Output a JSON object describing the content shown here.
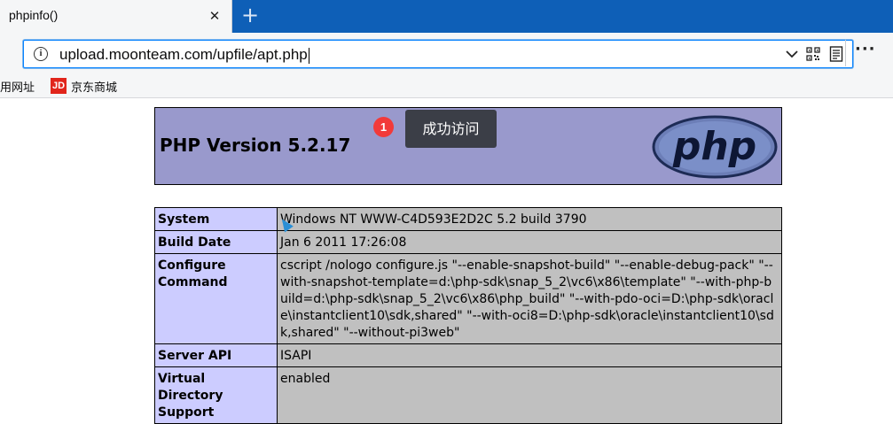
{
  "tab": {
    "title": "phpinfo()",
    "close_glyph": "✕",
    "new_tab_glyph": "+"
  },
  "address_bar": {
    "url": "upload.moonteam.com/upfile/apt.php"
  },
  "toolbar": {
    "more_glyph": "···"
  },
  "bookmarks": [
    {
      "label": "用网址"
    },
    {
      "label": "京东商城",
      "icon": "jd-icon",
      "icon_text": "JD"
    }
  ],
  "page": {
    "php_version": "PHP Version 5.2.17",
    "logo_text": "php",
    "callout": {
      "number": "1",
      "text": "成功访问"
    },
    "rows": [
      {
        "key": "System",
        "value": "Windows NT WWW-C4D593E2D2C 5.2 build 3790"
      },
      {
        "key": "Build Date",
        "value": "Jan 6 2011 17:26:08"
      },
      {
        "key": "Configure Command",
        "value": "cscript /nologo configure.js \"--enable-snapshot-build\" \"--enable-debug-pack\" \"--with-snapshot-template=d:\\php-sdk\\snap_5_2\\vc6\\x86\\template\" \"--with-php-build=d:\\php-sdk\\snap_5_2\\vc6\\x86\\php_build\" \"--with-pdo-oci=D:\\php-sdk\\oracle\\instantclient10\\sdk,shared\" \"--with-oci8=D:\\php-sdk\\oracle\\instantclient10\\sdk,shared\" \"--without-pi3web\""
      },
      {
        "key": "Server API",
        "value": "ISAPI"
      },
      {
        "key": "Virtual Directory Support",
        "value": "enabled"
      }
    ]
  },
  "colors": {
    "tabstrip": "#0e5fb7",
    "header_bg": "#9999cc",
    "key_bg": "#ccccff",
    "value_bg": "#c0c0c0",
    "badge": "#f23a3a",
    "tooltip": "#3b3e47"
  }
}
